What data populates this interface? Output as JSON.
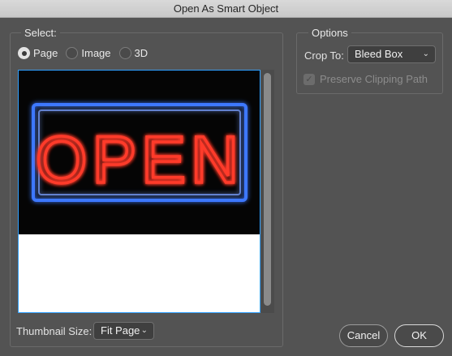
{
  "window": {
    "title": "Open As Smart Object"
  },
  "select_group": {
    "legend": "Select:",
    "radios": [
      {
        "label": "Page",
        "checked": true
      },
      {
        "label": "Image",
        "checked": false
      },
      {
        "label": "3D",
        "checked": false
      }
    ],
    "preview": {
      "image_text": "OPEN"
    },
    "thumbnail_size": {
      "label": "Thumbnail Size:",
      "value": "Fit Page"
    }
  },
  "options_group": {
    "legend": "Options",
    "crop_to": {
      "label": "Crop To:",
      "value": "Bleed Box"
    },
    "preserve_clipping_path": {
      "label": "Preserve Clipping Path",
      "checked": true,
      "disabled": true
    }
  },
  "buttons": {
    "cancel": "Cancel",
    "ok": "OK"
  },
  "colors": {
    "dialog_bg": "#535353",
    "preview_border": "#2fa0ff",
    "neon_red": "#ff3a2a",
    "neon_blue": "#3e78ff"
  }
}
